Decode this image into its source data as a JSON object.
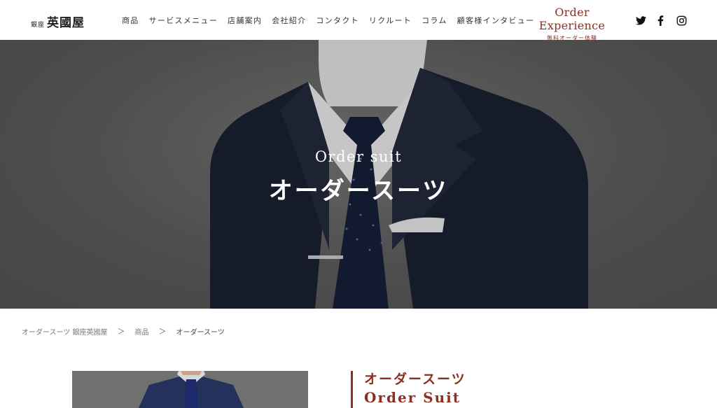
{
  "header": {
    "logo_small": "銀座",
    "logo_main": "英國屋",
    "nav": [
      "商品",
      "サービスメニュー",
      "店舗案内",
      "会社紹介",
      "コンタクト",
      "リクルート",
      "コラム",
      "顧客様インタビュー"
    ],
    "cta_title": "Order Experience",
    "cta_sub": "無料オーダー体験",
    "social_icons": [
      "twitter-icon",
      "facebook-icon",
      "instagram-icon"
    ]
  },
  "hero": {
    "title_en": "Order suit",
    "title_ja": "オーダースーツ"
  },
  "breadcrumb": {
    "items": [
      "オーダースーツ 銀座英國屋",
      "商品",
      "オーダースーツ"
    ],
    "separator": "＞"
  },
  "section": {
    "title_ja": "オーダースーツ",
    "title_en": "Order Suit"
  },
  "colors": {
    "accent": "#8e2f22",
    "hero_overlay": "#5f5f5f",
    "suit_navy": "#1c2233"
  }
}
